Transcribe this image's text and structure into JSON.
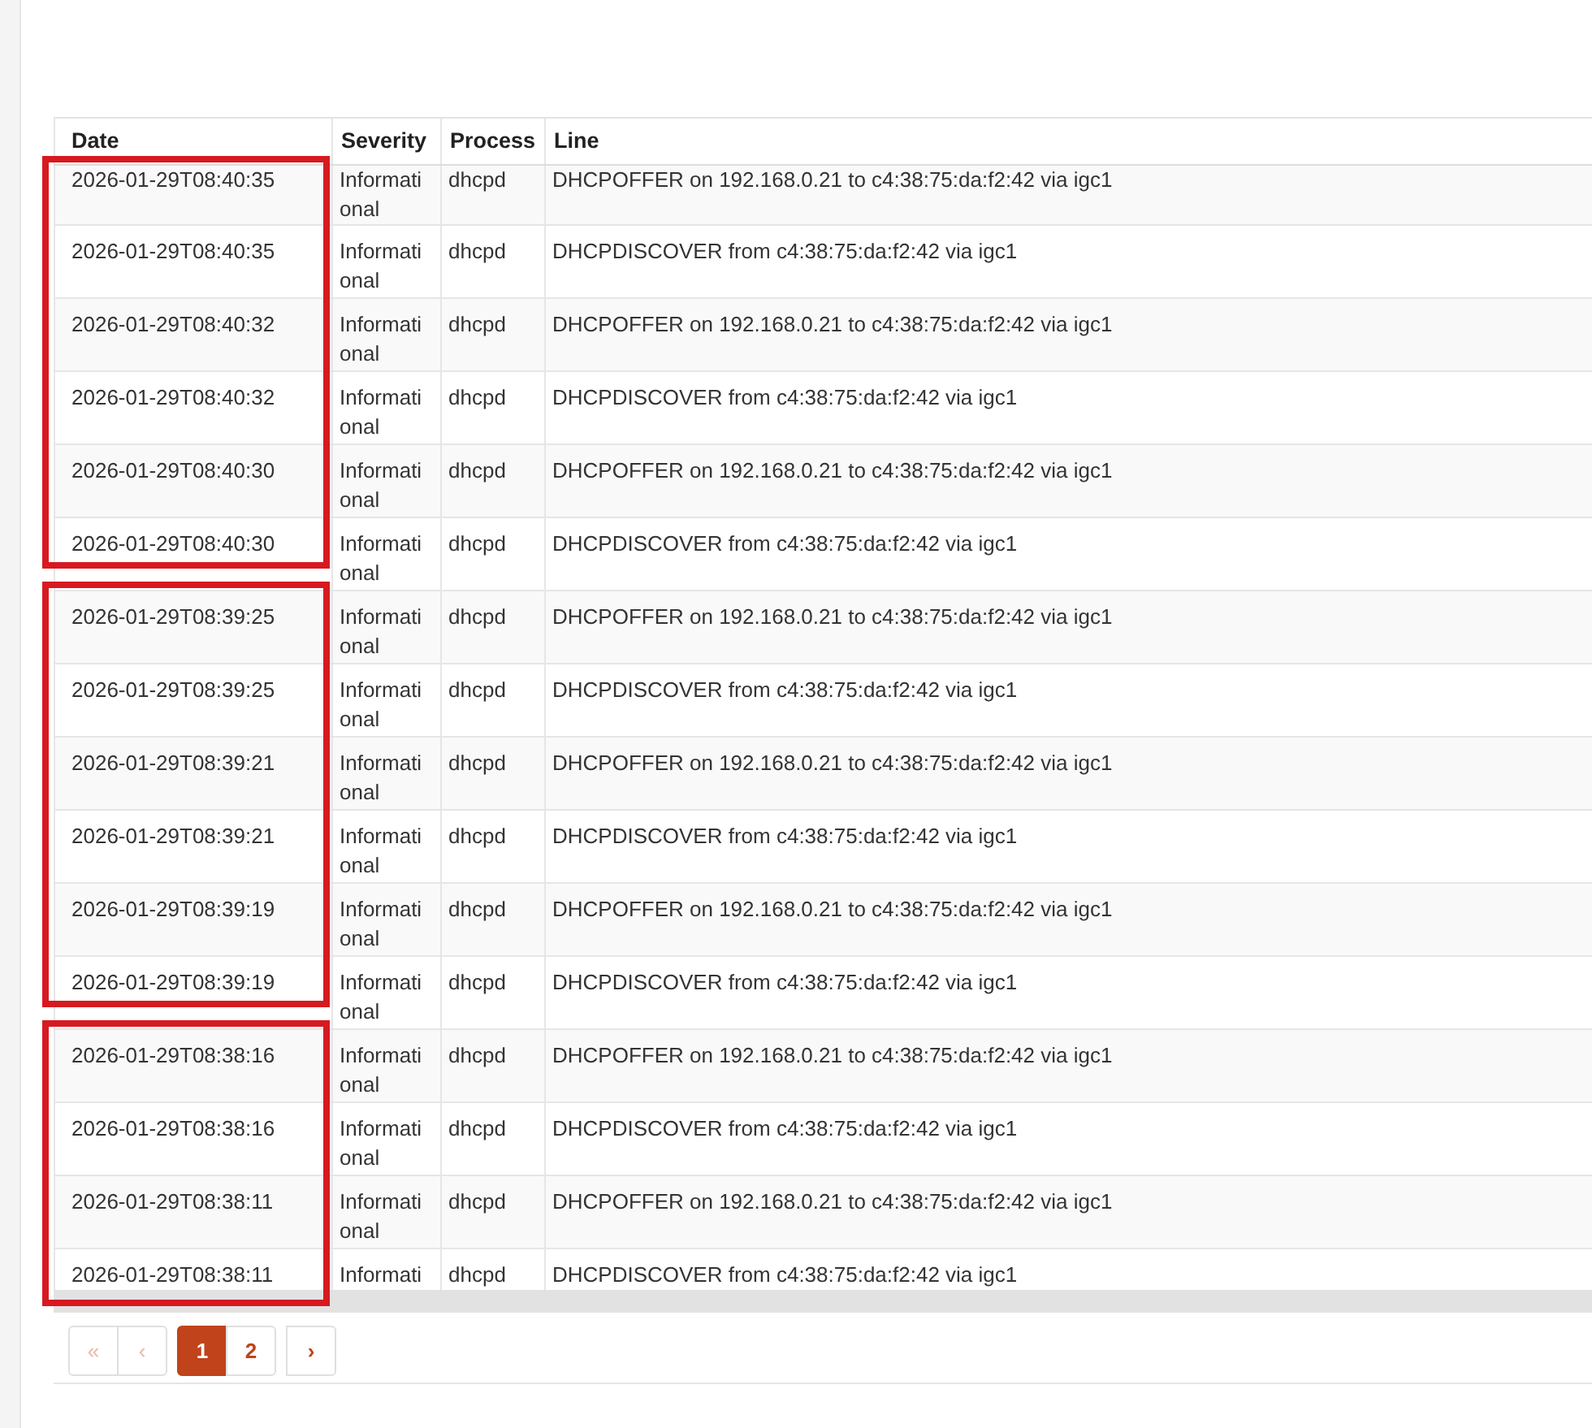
{
  "table": {
    "columns": [
      "Date",
      "Severity",
      "Process",
      "Line"
    ],
    "row_groups": [
      {
        "highlighted": true,
        "rows": [
          {
            "date": "2026-01-29T08:40:35",
            "severity": "Informational",
            "process": "dhcpd",
            "line": "DHCPOFFER on 192.168.0.21 to c4:38:75:da:f2:42 via igc1"
          },
          {
            "date": "2026-01-29T08:40:35",
            "severity": "Informational",
            "process": "dhcpd",
            "line": "DHCPDISCOVER from c4:38:75:da:f2:42 via igc1"
          },
          {
            "date": "2026-01-29T08:40:32",
            "severity": "Informational",
            "process": "dhcpd",
            "line": "DHCPOFFER on 192.168.0.21 to c4:38:75:da:f2:42 via igc1"
          },
          {
            "date": "2026-01-29T08:40:32",
            "severity": "Informational",
            "process": "dhcpd",
            "line": "DHCPDISCOVER from c4:38:75:da:f2:42 via igc1"
          },
          {
            "date": "2026-01-29T08:40:30",
            "severity": "Informational",
            "process": "dhcpd",
            "line": "DHCPOFFER on 192.168.0.21 to c4:38:75:da:f2:42 via igc1"
          },
          {
            "date": "2026-01-29T08:40:30",
            "severity": "Informational",
            "process": "dhcpd",
            "line": "DHCPDISCOVER from c4:38:75:da:f2:42 via igc1"
          }
        ]
      },
      {
        "highlighted": true,
        "rows": [
          {
            "date": "2026-01-29T08:39:25",
            "severity": "Informational",
            "process": "dhcpd",
            "line": "DHCPOFFER on 192.168.0.21 to c4:38:75:da:f2:42 via igc1"
          },
          {
            "date": "2026-01-29T08:39:25",
            "severity": "Informational",
            "process": "dhcpd",
            "line": "DHCPDISCOVER from c4:38:75:da:f2:42 via igc1"
          },
          {
            "date": "2026-01-29T08:39:21",
            "severity": "Informational",
            "process": "dhcpd",
            "line": "DHCPOFFER on 192.168.0.21 to c4:38:75:da:f2:42 via igc1"
          },
          {
            "date": "2026-01-29T08:39:21",
            "severity": "Informational",
            "process": "dhcpd",
            "line": "DHCPDISCOVER from c4:38:75:da:f2:42 via igc1"
          },
          {
            "date": "2026-01-29T08:39:19",
            "severity": "Informational",
            "process": "dhcpd",
            "line": "DHCPOFFER on 192.168.0.21 to c4:38:75:da:f2:42 via igc1"
          },
          {
            "date": "2026-01-29T08:39:19",
            "severity": "Informational",
            "process": "dhcpd",
            "line": "DHCPDISCOVER from c4:38:75:da:f2:42 via igc1"
          }
        ]
      },
      {
        "highlighted": true,
        "rows": [
          {
            "date": "2026-01-29T08:38:16",
            "severity": "Informational",
            "process": "dhcpd",
            "line": "DHCPOFFER on 192.168.0.21 to c4:38:75:da:f2:42 via igc1"
          },
          {
            "date": "2026-01-29T08:38:16",
            "severity": "Informational",
            "process": "dhcpd",
            "line": "DHCPDISCOVER from c4:38:75:da:f2:42 via igc1"
          },
          {
            "date": "2026-01-29T08:38:11",
            "severity": "Informational",
            "process": "dhcpd",
            "line": "DHCPOFFER on 192.168.0.21 to c4:38:75:da:f2:42 via igc1"
          },
          {
            "date": "2026-01-29T08:38:11",
            "severity": "Informati",
            "process": "dhcpd",
            "line": "DHCPDISCOVER from c4:38:75:da:f2:42 via igc1"
          }
        ]
      }
    ]
  },
  "pagination": {
    "nav_start": [
      {
        "label": "«",
        "disabled": true
      },
      {
        "label": "‹",
        "disabled": true
      }
    ],
    "pages": [
      {
        "label": "1",
        "selected": true
      },
      {
        "label": "2",
        "selected": false
      }
    ],
    "nav_end": [
      {
        "label": "›",
        "disabled": false
      }
    ]
  }
}
